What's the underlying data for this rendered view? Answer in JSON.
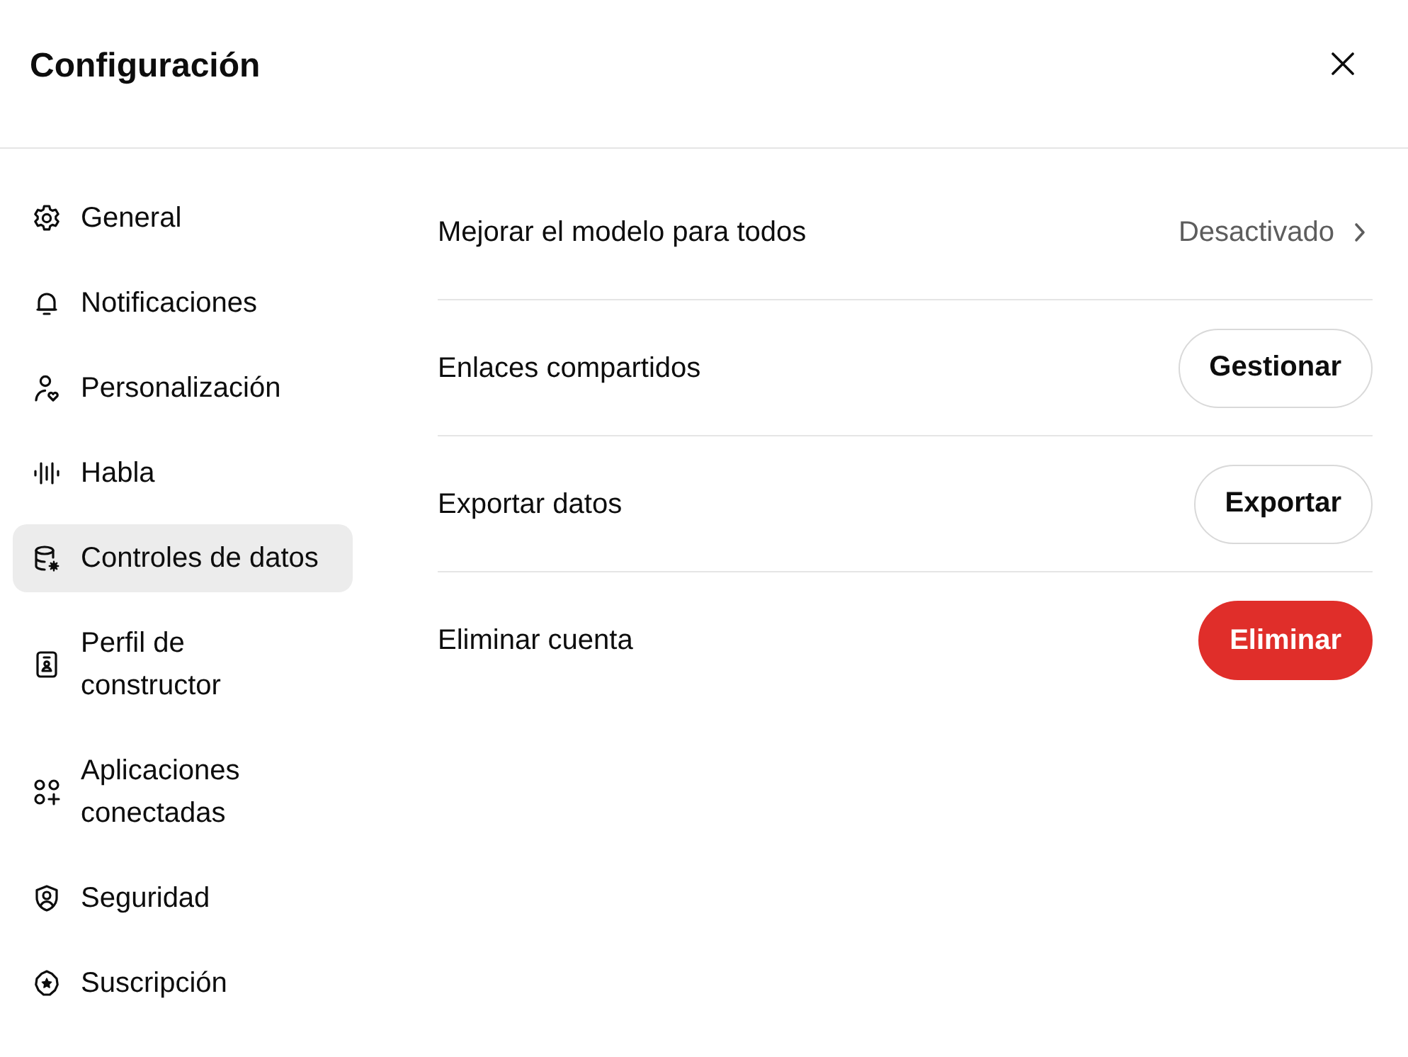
{
  "window": {
    "title": "Configuración"
  },
  "sidebar": {
    "items": [
      {
        "label": "General",
        "selected": false
      },
      {
        "label": "Notificaciones",
        "selected": false
      },
      {
        "label": "Personalización",
        "selected": false
      },
      {
        "label": "Habla",
        "selected": false
      },
      {
        "label": "Controles de datos",
        "selected": true
      },
      {
        "label": "Perfil de constructor",
        "selected": false
      },
      {
        "label": "Aplicaciones conectadas",
        "selected": false
      },
      {
        "label": "Seguridad",
        "selected": false
      },
      {
        "label": "Suscripción",
        "selected": false
      }
    ]
  },
  "settings": [
    {
      "kind": "link",
      "label": "Mejorar el modelo para todos",
      "value": "Desactivado"
    },
    {
      "kind": "button",
      "label": "Enlaces compartidos",
      "button": "Gestionar"
    },
    {
      "kind": "button",
      "label": "Exportar datos",
      "button": "Exportar"
    },
    {
      "kind": "danger_button",
      "label": "Eliminar cuenta",
      "button": "Eliminar"
    }
  ]
}
